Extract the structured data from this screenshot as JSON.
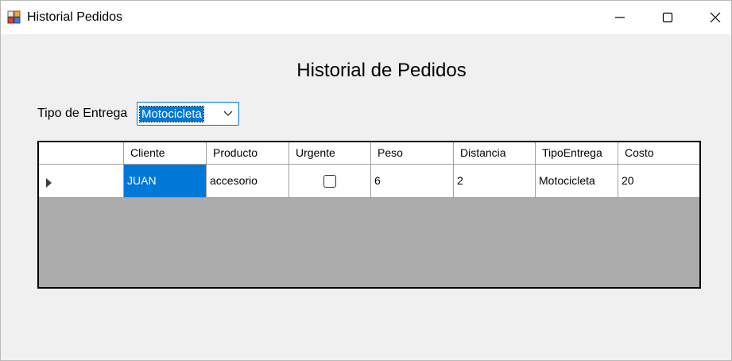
{
  "window": {
    "title": "Historial Pedidos"
  },
  "page": {
    "title": "Historial de Pedidos"
  },
  "filter": {
    "label": "Tipo de Entrega",
    "selected": "Motocicleta"
  },
  "grid": {
    "columns": [
      "Cliente",
      "Producto",
      "Urgente",
      "Peso",
      "Distancia",
      "TipoEntrega",
      "Costo"
    ],
    "rows": [
      {
        "cliente": "JUAN",
        "producto": "accesorio",
        "urgente": false,
        "peso": "6",
        "distancia": "2",
        "tipo_entrega": "Motocicleta",
        "costo": "20"
      }
    ]
  },
  "colors": {
    "selection": "#0078d7",
    "grid_background": "#ababab",
    "window_background": "#f0f0f0"
  },
  "icons": [
    "app-icon",
    "minimize-icon",
    "maximize-icon",
    "close-icon",
    "chevron-down-icon",
    "row-indicator-icon"
  ]
}
